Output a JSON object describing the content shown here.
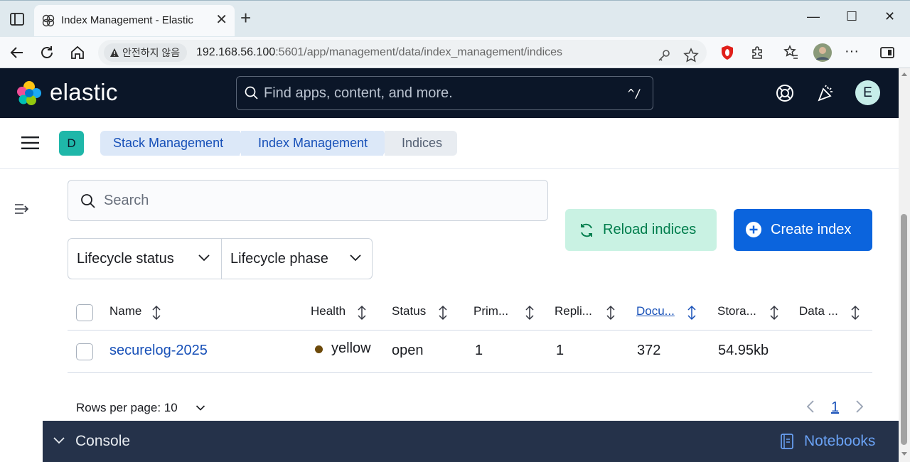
{
  "browser": {
    "tab_title": "Index Management - Elastic",
    "new_tab": "+",
    "close_tab": "✕",
    "security_label": "안전하지 않음",
    "url_host": "192.168.56.100",
    "url_rest": ":5601/app/management/data/index_management/indices",
    "window_controls": [
      "—",
      "☐",
      "✕"
    ]
  },
  "header": {
    "logo_text": "elastic",
    "search_placeholder": "Find apps, content, and more.",
    "search_shortcut": "^/",
    "user_initial": "E"
  },
  "subheader": {
    "space_initial": "D",
    "breadcrumbs": [
      "Stack Management",
      "Index Management",
      "Indices"
    ]
  },
  "toolbar": {
    "search_placeholder": "Search",
    "filters": [
      "Lifecycle status",
      "Lifecycle phase"
    ],
    "reload_label": "Reload indices",
    "create_label": "Create index"
  },
  "table": {
    "columns": [
      "Name",
      "Health",
      "Status",
      "Prim...",
      "Repli...",
      "Docu...",
      "Stora...",
      "Data ..."
    ],
    "rows": [
      {
        "name": "securelog-2025",
        "health": "yellow",
        "status": "open",
        "primaries": "1",
        "replicas": "1",
        "docs": "372",
        "storage": "54.95kb",
        "data_stream": ""
      }
    ]
  },
  "pagination": {
    "rows_per_page": "Rows per page: 10",
    "current_page": "1"
  },
  "console": {
    "label": "Console",
    "notebooks_label": "Notebooks"
  },
  "colors": {
    "header_bg": "#0b1628",
    "primary": "#0b64dd",
    "success_bg": "#c9f2e3",
    "success_text": "#007d4c",
    "link": "#1750b8",
    "health_yellow": "#6d4a0a"
  }
}
